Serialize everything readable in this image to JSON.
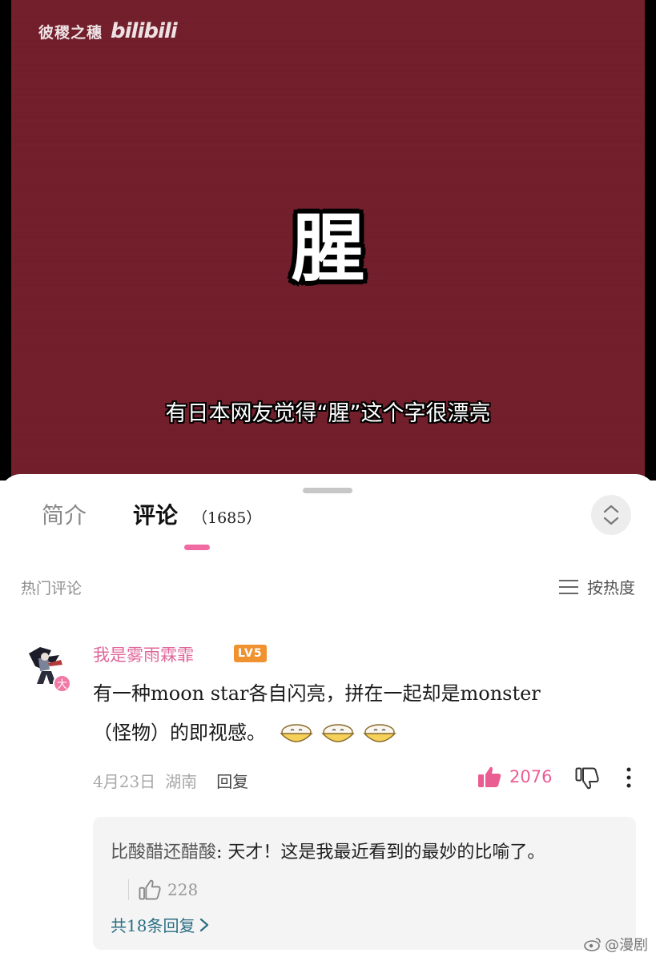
{
  "video": {
    "channel_name": "彼稷之穗",
    "platform_logo": "bilibili",
    "big_character": "腥",
    "subtitle": "有日本网友觉得“腥”这个字很漂亮",
    "background_color": "#74202c"
  },
  "tabs": [
    {
      "label": "简介",
      "active": false
    },
    {
      "label": "评论",
      "active": true,
      "count": "（1685）"
    }
  ],
  "comments_header": {
    "section_label": "热门评论",
    "sort_label": "按热度",
    "sort_icon": "list-sort-icon"
  },
  "comment": {
    "username": "我是雾雨霖霏",
    "level": "LV5",
    "avatar_badge": "大",
    "text_line1": "有一种moon star各自闪亮，拼在一起却是monster",
    "text_line2": "（怪物）的即视感。",
    "emoji_count": 3,
    "date": "4月23日",
    "location": "湖南",
    "reply_label": "回复",
    "like_count": "2076",
    "accent_color": "#ea5d92"
  },
  "reply": {
    "author": "比酸醋还醋酸",
    "text": ": 天才！这是我最近看到的最妙的比喻了。",
    "like_count": "228",
    "more_replies": "共18条回复"
  },
  "footer": {
    "watermark": "@漫剧"
  }
}
